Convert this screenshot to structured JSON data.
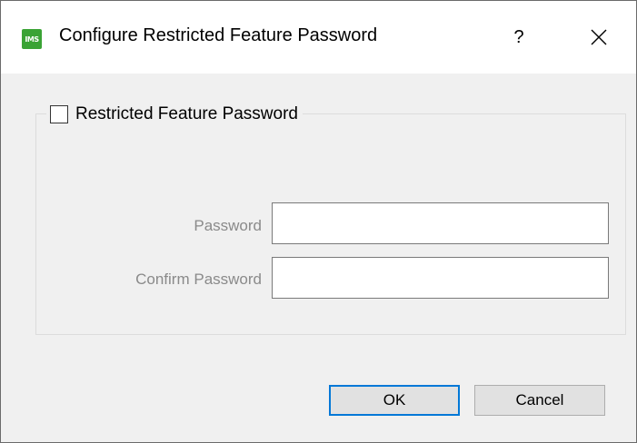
{
  "window": {
    "title": "Configure Restricted Feature Password",
    "app_icon_text": "IMS",
    "help_label": "?",
    "close_label": "close"
  },
  "group": {
    "checkbox_label": "Restricted Feature Password",
    "checked": false
  },
  "fields": {
    "password": {
      "label": "Password",
      "value": ""
    },
    "confirm_password": {
      "label": "Confirm Password",
      "value": ""
    }
  },
  "buttons": {
    "ok_label": "OK",
    "cancel_label": "Cancel"
  },
  "colors": {
    "accent": "#0078d7",
    "app_icon": "#3aa335",
    "disabled_text": "#8a8a8a"
  }
}
